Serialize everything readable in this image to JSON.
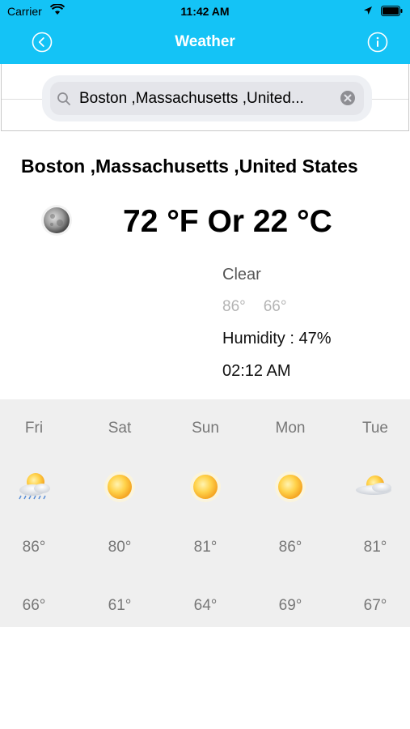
{
  "status_bar": {
    "carrier": "Carrier",
    "time": "11:42 AM"
  },
  "nav": {
    "title": "Weather",
    "back_icon": "back-circle-icon",
    "info_icon": "info-circle-icon",
    "bar_color": "#14c3f6"
  },
  "search": {
    "value": "Boston ,Massachusetts ,United..."
  },
  "current": {
    "city": "Boston ,Massachusetts ,United States",
    "temperature": "72 °F Or 22 °C",
    "condition": "Clear",
    "high": "86°",
    "low": "66°",
    "humidity": "Humidity : 47%",
    "time": "02:12 AM",
    "icon": "moon-icon"
  },
  "forecast": [
    {
      "day": "Fri",
      "high": "86°",
      "low": "66°",
      "icon": "sun-cloud-rain-icon"
    },
    {
      "day": "Sat",
      "high": "80°",
      "low": "61°",
      "icon": "sun-icon"
    },
    {
      "day": "Sun",
      "high": "81°",
      "low": "64°",
      "icon": "sun-icon"
    },
    {
      "day": "Mon",
      "high": "86°",
      "low": "69°",
      "icon": "sun-icon"
    },
    {
      "day": "Tue",
      "high": "81°",
      "low": "67°",
      "icon": "sun-cloud-icon"
    }
  ]
}
